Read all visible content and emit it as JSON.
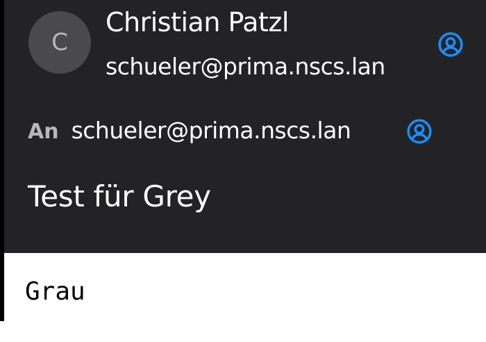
{
  "sender": {
    "avatar_initial": "C",
    "name": "Christian Patzl",
    "email": "schueler@prima.nscs.lan",
    "contact_icon": "contact-card-icon"
  },
  "recipients": {
    "label": "An",
    "email": "schueler@prima.nscs.lan",
    "contact_icon": "contact-card-icon"
  },
  "subject": "Test für Grey",
  "body": {
    "text": "Grau"
  },
  "colors": {
    "header_background": "#232326",
    "avatar_background": "#4a4a4e",
    "accent": "#1a8fff",
    "body_background": "#ffffff"
  }
}
